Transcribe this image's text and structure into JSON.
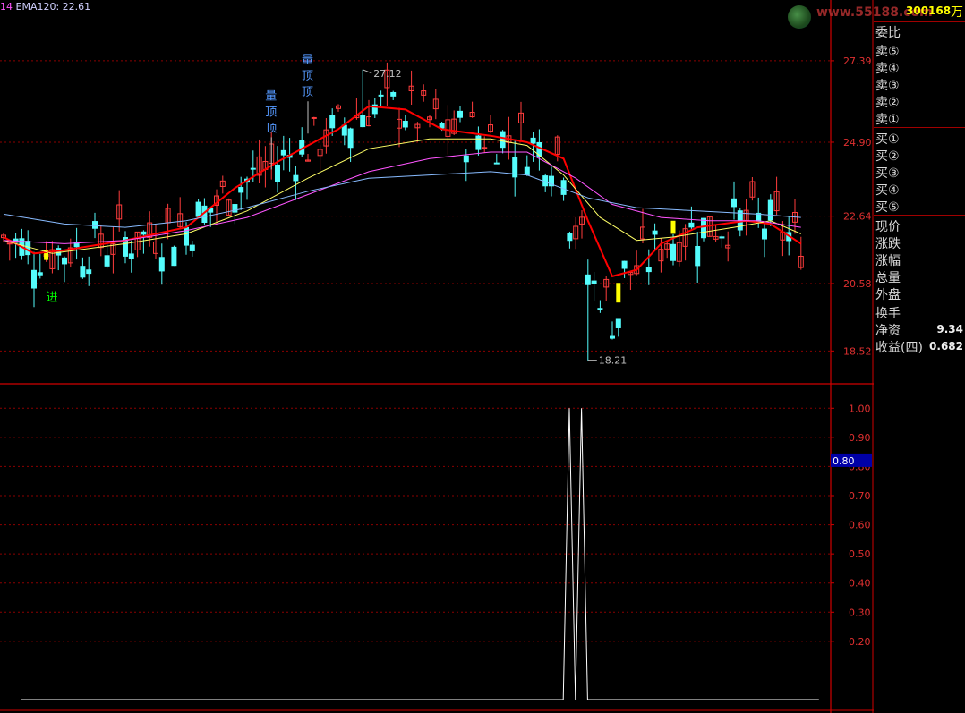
{
  "header": {
    "prefix": "14",
    "indicator": "EMA120: 22.61"
  },
  "watermark": "www.55188.com",
  "sidebar": {
    "code": "300168",
    "name": "万",
    "rows": [
      {
        "label": "委比",
        "value": ""
      },
      {
        "label": "卖⑤",
        "value": ""
      },
      {
        "label": "卖④",
        "value": ""
      },
      {
        "label": "卖③",
        "value": ""
      },
      {
        "label": "卖②",
        "value": ""
      },
      {
        "label": "卖①",
        "value": ""
      },
      {
        "label": "买①",
        "value": ""
      },
      {
        "label": "买②",
        "value": ""
      },
      {
        "label": "买③",
        "value": ""
      },
      {
        "label": "买④",
        "value": ""
      },
      {
        "label": "买⑤",
        "value": ""
      },
      {
        "label": "现价",
        "value": ""
      },
      {
        "label": "涨跌",
        "value": ""
      },
      {
        "label": "涨幅",
        "value": ""
      },
      {
        "label": "总量",
        "value": ""
      },
      {
        "label": "外盘",
        "value": ""
      },
      {
        "label": "换手",
        "value": ""
      },
      {
        "label": "净资",
        "value": "9.34"
      },
      {
        "label": "收益(四)",
        "value": "0.682"
      }
    ]
  },
  "colors": {
    "up": "#ff3c3c",
    "down": "#54fcfc",
    "ma_red": "#ff0000",
    "ma_yellow": "#ffff66",
    "ma_magenta": "#ff55ff",
    "ma_blue": "#88bbff",
    "grid": "#8b0000",
    "axis": "#d00000",
    "label_blue": "#5599ff",
    "enter": "#00ff00"
  },
  "chart_data": [
    {
      "type": "candlestick",
      "title": "",
      "ylim": [
        17.9,
        28.7
      ],
      "yticks": [
        27.39,
        24.9,
        22.64,
        20.58,
        18.52
      ],
      "ytick_labels": [
        "27.39",
        "24.90",
        "22.64",
        "20.58",
        "18.52"
      ],
      "high_label": "27.12",
      "low_label": "18.21",
      "high_value": 27.12,
      "low_value": 18.21,
      "annotations": [
        {
          "text": "量顶顶",
          "x_index": 50,
          "price": 27.3
        },
        {
          "text": "量顶顶",
          "x_index": 44,
          "price": 26.2
        },
        {
          "text": "进",
          "x_index": 7,
          "price": 20.1
        }
      ],
      "series": [
        {
          "name": "",
          "type": "ma",
          "color_key": "ma_red",
          "points": [
            [
              0,
              22.0
            ],
            [
              5,
              21.5
            ],
            [
              10,
              21.6
            ],
            [
              20,
              21.9
            ],
            [
              30,
              22.3
            ],
            [
              38,
              23.5
            ],
            [
              45,
              24.3
            ],
            [
              55,
              25.3
            ],
            [
              60,
              26.0
            ],
            [
              66,
              25.9
            ],
            [
              72,
              25.3
            ],
            [
              80,
              25.1
            ],
            [
              86,
              24.9
            ],
            [
              92,
              24.4
            ],
            [
              96,
              22.5
            ],
            [
              100,
              20.8
            ],
            [
              104,
              21.0
            ],
            [
              108,
              21.8
            ],
            [
              114,
              22.3
            ],
            [
              122,
              22.5
            ],
            [
              126,
              22.4
            ],
            [
              131,
              21.8
            ]
          ]
        },
        {
          "name": "",
          "type": "ma",
          "color_key": "ma_yellow",
          "points": [
            [
              0,
              21.9
            ],
            [
              8,
              21.5
            ],
            [
              20,
              21.8
            ],
            [
              30,
              22.1
            ],
            [
              40,
              22.8
            ],
            [
              50,
              23.8
            ],
            [
              60,
              24.7
            ],
            [
              70,
              25.0
            ],
            [
              80,
              25.0
            ],
            [
              86,
              24.8
            ],
            [
              92,
              23.9
            ],
            [
              98,
              22.6
            ],
            [
              104,
              21.9
            ],
            [
              110,
              22.0
            ],
            [
              120,
              22.3
            ],
            [
              126,
              22.5
            ],
            [
              131,
              22.1
            ]
          ]
        },
        {
          "name": "",
          "type": "ma",
          "color_key": "ma_magenta",
          "points": [
            [
              0,
              21.9
            ],
            [
              10,
              21.8
            ],
            [
              20,
              21.9
            ],
            [
              30,
              22.2
            ],
            [
              40,
              22.6
            ],
            [
              50,
              23.3
            ],
            [
              60,
              24.0
            ],
            [
              70,
              24.4
            ],
            [
              80,
              24.6
            ],
            [
              86,
              24.6
            ],
            [
              94,
              23.8
            ],
            [
              100,
              23.0
            ],
            [
              108,
              22.6
            ],
            [
              116,
              22.5
            ],
            [
              124,
              22.5
            ],
            [
              131,
              22.3
            ]
          ]
        },
        {
          "name": "",
          "type": "ma",
          "color_key": "ma_blue",
          "points": [
            [
              0,
              22.7
            ],
            [
              10,
              22.4
            ],
            [
              20,
              22.3
            ],
            [
              30,
              22.5
            ],
            [
              40,
              22.9
            ],
            [
              50,
              23.4
            ],
            [
              60,
              23.8
            ],
            [
              70,
              23.9
            ],
            [
              80,
              24.0
            ],
            [
              86,
              23.9
            ],
            [
              96,
              23.2
            ],
            [
              104,
              22.9
            ],
            [
              114,
              22.8
            ],
            [
              124,
              22.7
            ],
            [
              131,
              22.6
            ]
          ]
        }
      ]
    },
    {
      "type": "line",
      "title": "",
      "ylim": [
        0,
        1.05
      ],
      "yticks": [
        1.0,
        0.9,
        0.8,
        0.7,
        0.6,
        0.5,
        0.4,
        0.3,
        0.2
      ],
      "ytick_labels": [
        "1.00",
        "0.90",
        "0.80",
        "0.70",
        "0.60",
        "0.50",
        "0.40",
        "0.30",
        "0.20"
      ],
      "current_value_label": "0.80",
      "x": [
        0,
        89,
        90,
        91,
        92,
        93,
        131
      ],
      "values": [
        0,
        0,
        1,
        0,
        1,
        0,
        0
      ]
    }
  ]
}
